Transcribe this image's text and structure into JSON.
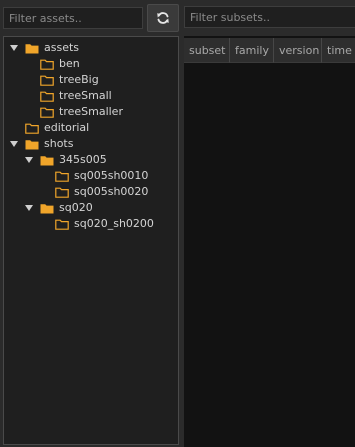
{
  "assets_filter": {
    "placeholder": "Filter assets.."
  },
  "subsets_filter": {
    "placeholder": "Filter subsets.."
  },
  "refresh": {
    "icon": "refresh-icon"
  },
  "colors": {
    "folder": "#f0a52a",
    "arrow": "#cfcfcf",
    "background": "#2b2b2b",
    "panel": "#1f1f1f",
    "view": "#121212"
  },
  "tree": [
    {
      "label": "assets",
      "depth": 0,
      "expanded": true,
      "has_children": true,
      "folder": "filled"
    },
    {
      "label": "ben",
      "depth": 1,
      "has_children": false,
      "folder": "outline"
    },
    {
      "label": "treeBig",
      "depth": 1,
      "has_children": false,
      "folder": "outline"
    },
    {
      "label": "treeSmall",
      "depth": 1,
      "has_children": false,
      "folder": "outline"
    },
    {
      "label": "treeSmaller",
      "depth": 1,
      "has_children": false,
      "folder": "outline"
    },
    {
      "label": "editorial",
      "depth": 0,
      "has_children": false,
      "folder": "outline"
    },
    {
      "label": "shots",
      "depth": 0,
      "expanded": true,
      "has_children": true,
      "folder": "filled"
    },
    {
      "label": "345s005",
      "depth": 1,
      "expanded": true,
      "has_children": true,
      "folder": "filled"
    },
    {
      "label": "sq005sh0010",
      "depth": 2,
      "has_children": false,
      "folder": "outline"
    },
    {
      "label": "sq005sh0020",
      "depth": 2,
      "has_children": false,
      "folder": "outline"
    },
    {
      "label": "sq020",
      "depth": 1,
      "expanded": true,
      "has_children": true,
      "folder": "filled"
    },
    {
      "label": "sq020_sh0200",
      "depth": 2,
      "has_children": false,
      "folder": "outline"
    }
  ],
  "subset_columns": [
    {
      "label": "subset"
    },
    {
      "label": "family"
    },
    {
      "label": "version"
    },
    {
      "label": "time"
    }
  ]
}
